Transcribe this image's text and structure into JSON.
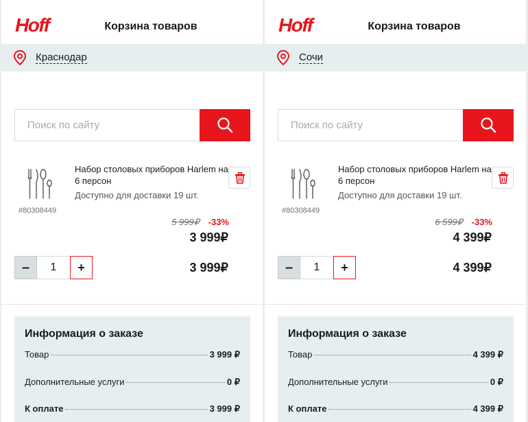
{
  "brand": {
    "logo_text": "Hoff",
    "accent_color": "#e8151d"
  },
  "panels": [
    {
      "header_title": "Корзина товаров",
      "city": "Краснодар",
      "search": {
        "placeholder": "Поиск по сайту"
      },
      "product": {
        "name": "Набор столовых приборов Harlem на 6 персон",
        "availability": "Доступно для доставки 19 шт.",
        "sku": "#80308449",
        "old_price": "5 999₽",
        "discount": "-33%",
        "unit_price": "3 999₽",
        "quantity": "1",
        "minus_label": "–",
        "plus_label": "+",
        "total_price": "3 999₽"
      },
      "order": {
        "title": "Информация о заказе",
        "rows": [
          {
            "label": "Товар",
            "value": "3 999 ₽"
          },
          {
            "label": "Дополнительные услуги",
            "value": "0 ₽"
          },
          {
            "label": "К оплате",
            "value": "3 999 ₽"
          }
        ]
      }
    },
    {
      "header_title": "Корзина товаров",
      "city": "Сочи",
      "search": {
        "placeholder": "Поиск по сайту"
      },
      "product": {
        "name": "Набор столовых приборов Harlem на 6 персон",
        "availability": "Доступно для доставки 19 шт.",
        "sku": "#80308449",
        "old_price": "6 599₽",
        "discount": "-33%",
        "unit_price": "4 399₽",
        "quantity": "1",
        "minus_label": "–",
        "plus_label": "+",
        "total_price": "4 399₽"
      },
      "order": {
        "title": "Информация о заказе",
        "rows": [
          {
            "label": "Товар",
            "value": "4 399 ₽"
          },
          {
            "label": "Дополнительные услуги",
            "value": "0 ₽"
          },
          {
            "label": "К оплате",
            "value": "4 399 ₽"
          }
        ]
      }
    }
  ]
}
